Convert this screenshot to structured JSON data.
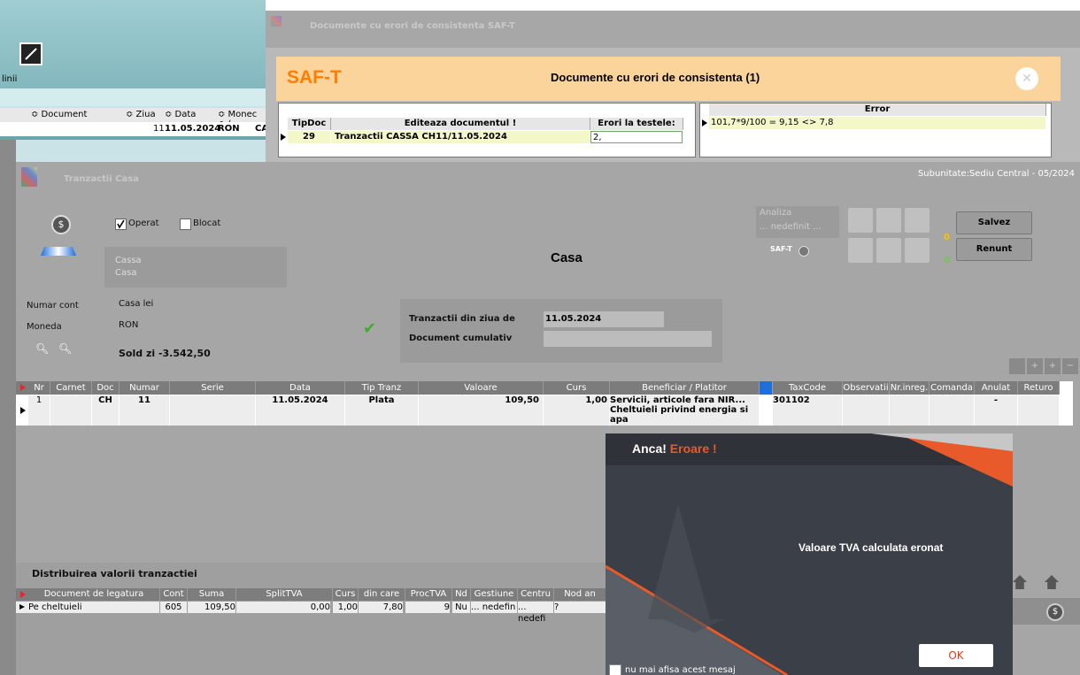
{
  "background_app": {
    "label_linii": "linii",
    "col_document": "≎ Document",
    "col_ziua": "≎ Ziua",
    "col_data": "≎ Data",
    "col_monec": "≎ Monec ≎ (",
    "row_ziua": "11",
    "row_data": "11.05.2024",
    "row_moneda": "RON",
    "row_tail": "CA"
  },
  "saft": {
    "window_title": "Documente cu erori de consistenta SAF-T",
    "brand": "SAF-T",
    "heading": "Documente cu erori de consistenta (1)",
    "left_headers": [
      "TipDoc",
      "Editeaza documentul !",
      "Erori la testele:"
    ],
    "left_row": [
      "29",
      "Tranzactii CASSA CH11/11.05.2024",
      "2,"
    ],
    "right_header": "Error",
    "right_row": "101,7*9/100 = 9,15 <> 7,8"
  },
  "casa": {
    "window_title": "Tranzactii Casa",
    "subunit": "Subunitate:Sediu Central - 05/2024",
    "operat": "Operat",
    "blocat": "Blocat",
    "type_line1": "Cassa",
    "type_line2": "Casa",
    "heading": "Casa",
    "analiza": "Analiza",
    "nedefinit": "... nedefinit ...",
    "saft_label": "SAF-T",
    "counter1": "0",
    "counter2": "0",
    "salvez": "Salvez",
    "renunt": "Renunt",
    "numar_cont_lbl": "Numar cont",
    "numar_cont_val": "Casa lei",
    "moneda_lbl": "Moneda",
    "moneda_val": "RON",
    "sold": "Sold zi -3.542,50",
    "tranz_lbl": "Tranzactii din ziua de",
    "tranz_val": "11.05.2024",
    "doc_cum_lbl": "Document cumulativ",
    "grid_headers": [
      "Nr",
      "Carnet",
      "Doc",
      "Numar",
      "Serie",
      "Data",
      "Tip Tranz",
      "Valoare",
      "Curs",
      "Beneficiar / Platitor",
      "TaxCode",
      "Observatii",
      "Nr.inreg.",
      "Comanda",
      "Anulat",
      "Returo"
    ],
    "grid_row": {
      "nr": "1",
      "doc": "CH",
      "numar": "11",
      "data": "11.05.2024",
      "tip": "Plata",
      "valoare": "109,50",
      "curs": "1,00",
      "benef1": "Servicii, articole fara NIR...",
      "benef2": "Cheltuieli privind energia si apa",
      "taxcode": "301102",
      "anulat": "-"
    },
    "dist_title": "Distribuirea valorii tranzactiei",
    "dist_headers": [
      "Document de legatura",
      "Cont",
      "Suma",
      "SplitTVA",
      "Curs",
      "din care TVA",
      "ProcTVA",
      "Nd",
      "Gestiune",
      "Centru",
      "Nod an"
    ],
    "dist_row": [
      "Pe cheltuieli",
      "605",
      "109,50",
      "0,00",
      "1,00",
      "7,80",
      "9",
      "Nu",
      "... nedefin",
      "... nedefi",
      "?"
    ]
  },
  "error_dialog": {
    "title_white": "Anca!",
    "title_orange": "Eroare !",
    "message": "Valoare TVA  calculata eronat",
    "ok": "OK",
    "checkbox_label": "nu mai afisa acest mesaj"
  },
  "colors": {
    "saft_orange": "#ff7d00",
    "saft_banner": "#fbd49b",
    "grid_highlight": "#f4f8c9",
    "error_accent": "#e85a2a"
  }
}
